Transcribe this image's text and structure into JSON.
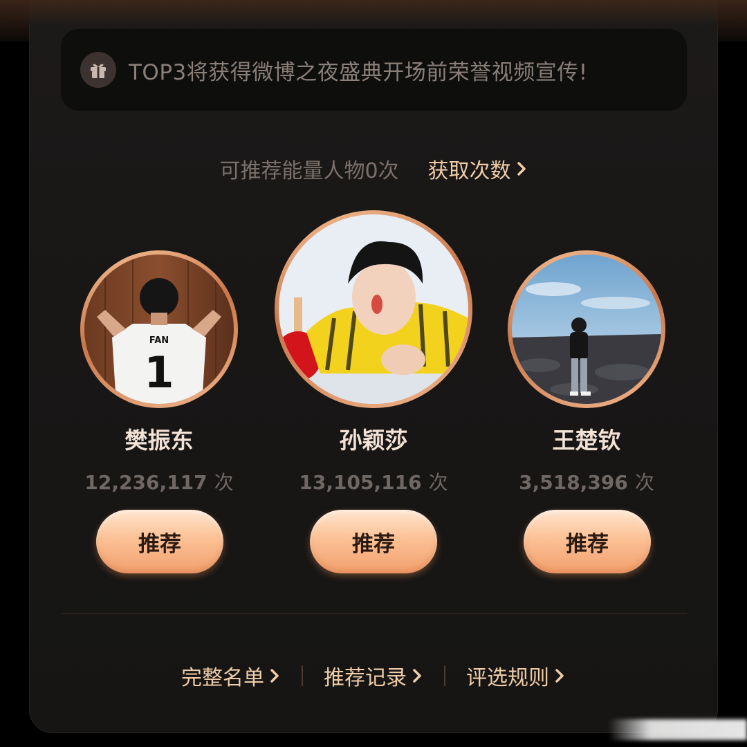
{
  "notice": {
    "icon": "gift-icon",
    "text": "TOP3将获得微博之夜盛典开场前荣誉视频宣传!"
  },
  "quota": {
    "text": "可推荐能量人物0次",
    "link_label": "获取次数",
    "link_icon": "chevron-right-icon"
  },
  "people": [
    {
      "name": "樊振东",
      "count": "12,236,117",
      "unit": "次",
      "button": "推荐"
    },
    {
      "name": "孙颖莎",
      "count": "13,105,116",
      "unit": "次",
      "button": "推荐"
    },
    {
      "name": "王楚钦",
      "count": "3,518,396",
      "unit": "次",
      "button": "推荐"
    }
  ],
  "footer": {
    "links": [
      {
        "label": "完整名单"
      },
      {
        "label": "推荐记录"
      },
      {
        "label": "评选规则"
      }
    ]
  },
  "colors": {
    "accent": "#f0cda8",
    "button_gradient_top": "#ffe6cf",
    "button_gradient_bottom": "#f2a06e",
    "card_bg": "#181716"
  }
}
